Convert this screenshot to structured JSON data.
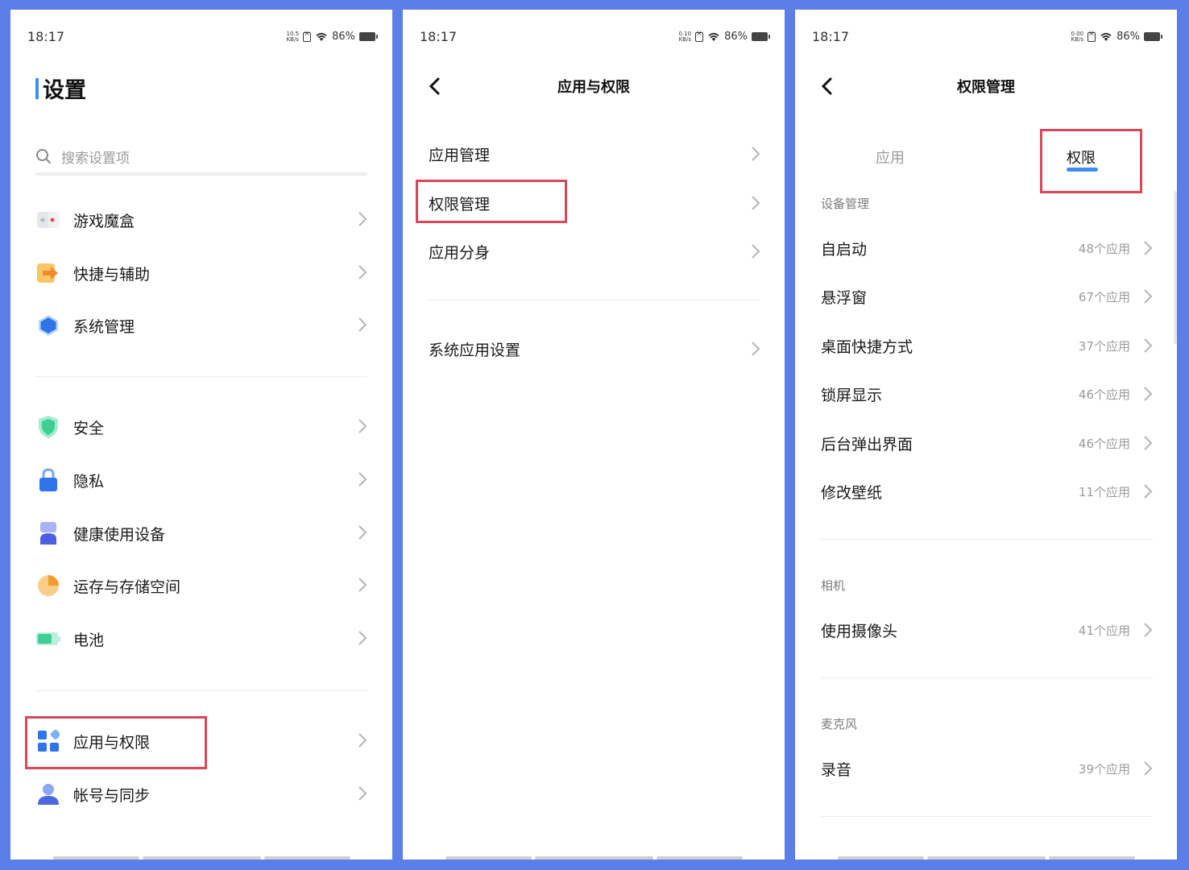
{
  "status_bar": [
    {
      "time": "18:17",
      "netspeed": "10.5",
      "netunit": "KB/s",
      "battery": "86%"
    },
    {
      "time": "18:17",
      "netspeed": "0.10",
      "netunit": "KB/s",
      "battery": "86%"
    },
    {
      "time": "18:17",
      "netspeed": "0.00",
      "netunit": "KB/s",
      "battery": "86%"
    }
  ],
  "settings": {
    "title": "设置",
    "search_placeholder": "搜索设置项",
    "group1": [
      {
        "label": "游戏魔盒",
        "icon": "game-box-icon"
      },
      {
        "label": "快捷与辅助",
        "icon": "shortcut-arrow-icon"
      },
      {
        "label": "系统管理",
        "icon": "hexagon-icon"
      }
    ],
    "group2": [
      {
        "label": "安全",
        "icon": "shield-icon"
      },
      {
        "label": "隐私",
        "icon": "lock-icon"
      },
      {
        "label": "健康使用设备",
        "icon": "hourglass-icon"
      },
      {
        "label": "运存与存储空间",
        "icon": "pie-chart-icon"
      },
      {
        "label": "电池",
        "icon": "battery-icon"
      }
    ],
    "group3": [
      {
        "label": "应用与权限",
        "icon": "apps-grid-icon"
      },
      {
        "label": "帐号与同步",
        "icon": "user-icon"
      }
    ]
  },
  "apps_perms": {
    "title": "应用与权限",
    "items": [
      {
        "label": "应用管理"
      },
      {
        "label": "权限管理"
      },
      {
        "label": "应用分身"
      }
    ],
    "items2": [
      {
        "label": "系统应用设置"
      }
    ]
  },
  "perm_mgmt": {
    "title": "权限管理",
    "tabs": [
      {
        "label": "应用",
        "active": false
      },
      {
        "label": "权限",
        "active": true
      }
    ],
    "sections": [
      {
        "title": "设备管理",
        "rows": [
          {
            "label": "自启动",
            "count": "48个应用"
          },
          {
            "label": "悬浮窗",
            "count": "67个应用"
          },
          {
            "label": "桌面快捷方式",
            "count": "37个应用"
          },
          {
            "label": "锁屏显示",
            "count": "46个应用"
          },
          {
            "label": "后台弹出界面",
            "count": "46个应用"
          },
          {
            "label": "修改壁纸",
            "count": "11个应用"
          }
        ]
      },
      {
        "title": "相机",
        "rows": [
          {
            "label": "使用摄像头",
            "count": "41个应用"
          }
        ]
      },
      {
        "title": "麦克风",
        "rows": [
          {
            "label": "录音",
            "count": "39个应用"
          }
        ]
      }
    ]
  },
  "colors": {
    "accent": "#3d8df0",
    "highlight": "#d9475a",
    "frame": "#5b7fe6"
  }
}
